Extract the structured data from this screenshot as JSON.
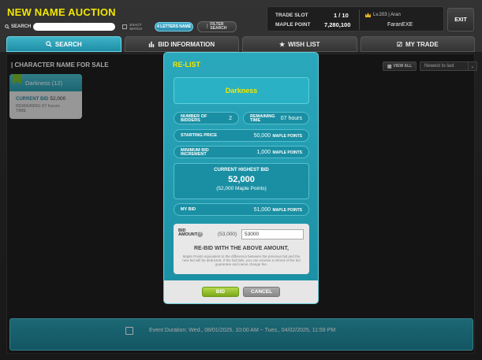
{
  "header": {
    "title": "NEW NAME AUCTION",
    "search_label": "SEARCH",
    "search_placeholder": "",
    "exact_match_label": "EXACT MATCH",
    "four_letters_label": "4 LETTERS NAME",
    "filter_label": "FILTER SEARCH"
  },
  "info": {
    "trade_slot_label": "TRADE SLOT",
    "trade_slot_value": "1 / 10",
    "maple_point_label": "MAPLE POINT",
    "maple_point_value": "7,280,100",
    "level_text": "Lv.203 | Aran",
    "character_name": "FaranEXE"
  },
  "exit_label": "EXIT",
  "tabs": [
    {
      "label": "SEARCH",
      "icon": "search-icon",
      "active": true
    },
    {
      "label": "BID INFORMATION",
      "icon": "bar-chart-icon",
      "active": false
    },
    {
      "label": "WISH LIST",
      "icon": "star-icon",
      "active": false
    },
    {
      "label": "MY TRADE",
      "icon": "checkbox-icon",
      "active": false
    }
  ],
  "section_title": "| CHARACTER NAME FOR SALE",
  "view_all_label": "VIEW ALL",
  "sort": {
    "selected": "Newest to last"
  },
  "card": {
    "name": "Darkness (12)",
    "current_bid_label": "CURRENT BID",
    "current_bid_value": "52,000",
    "remaining_label": "REMAINING",
    "remaining_value": "07 hours",
    "remaining_suffix": "TIME"
  },
  "event": {
    "text": "Event Duration: Wed., 08/01/2025, 10:00 AM ~ Tues., 04/02/2025, 11:59 PM"
  },
  "modal": {
    "title": "RE-LIST",
    "character_name": "Darkness",
    "bidders_label": "NUMBER OF BIDDERS",
    "bidders_value": "2",
    "remaining_label": "REMAINING TIME",
    "remaining_value": "07 hours",
    "starting_price_label": "STARTING PRICE",
    "starting_price_value": "50,000",
    "unit": "MAPLE POINTS",
    "min_increment_label": "MINIMUM BID INCREMENT",
    "min_increment_value": "1,000",
    "highest_bid_label": "CURRENT HIGHEST BID",
    "highest_bid_value": "52,000",
    "highest_bid_detail": "(52,000 Maple Points)",
    "my_bid_label": "MY BID",
    "my_bid_value": "51,000",
    "bid_amount_label": "BID AMOUNT",
    "bid_amount_ref": "(53,000)",
    "bid_amount_input": "53000",
    "rebid_headline": "RE-BID WITH THE ABOVE AMOUNT,",
    "rebid_note": "Maple Points equivalent to the difference between the previous bid and the new bid will be deducted. If the bid fails, you can receive a refund of the bid guarantee and name change fee.",
    "bid_button": "BID",
    "cancel_button": "CANCEL"
  }
}
